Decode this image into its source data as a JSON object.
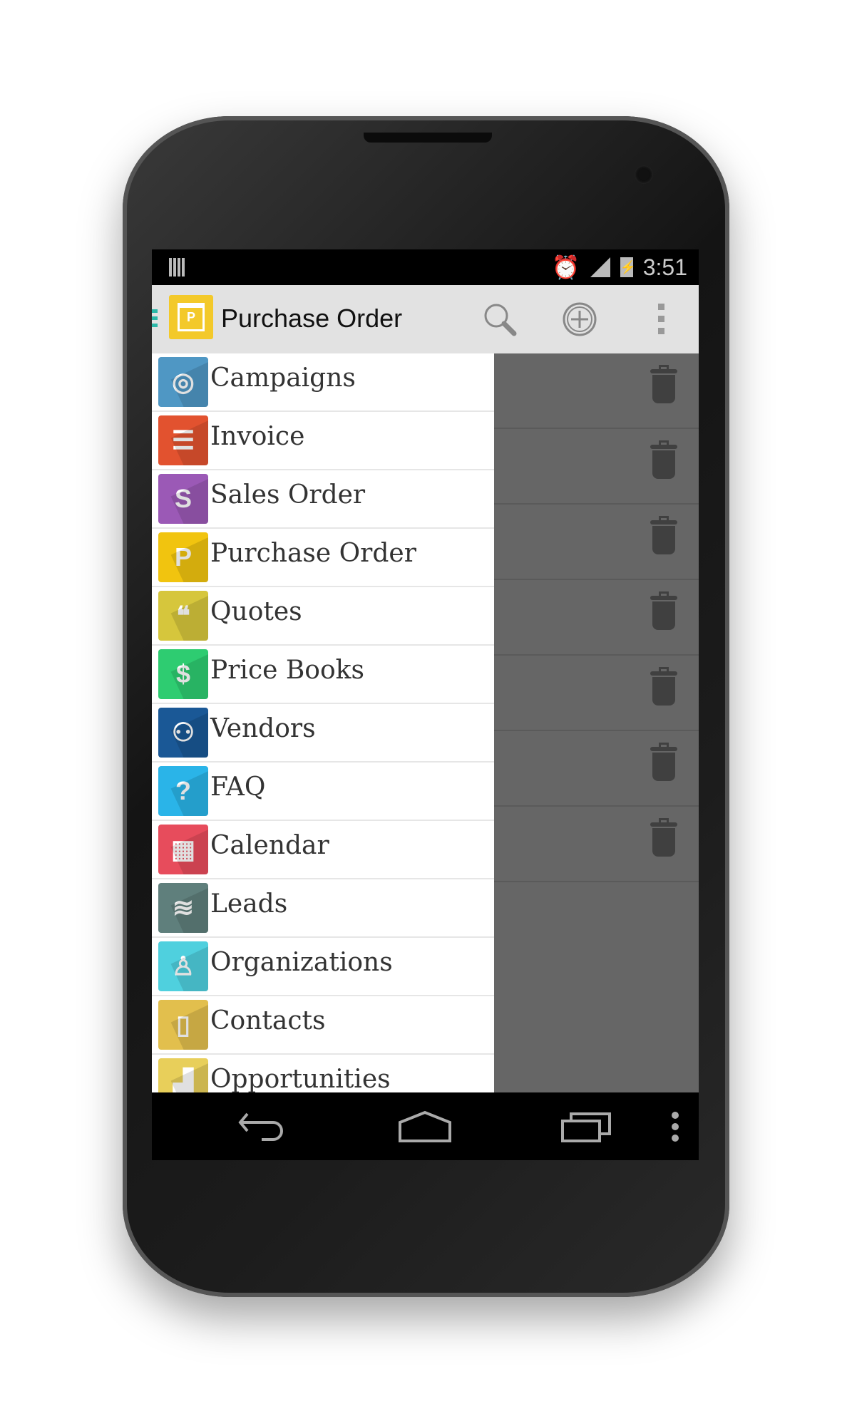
{
  "status_bar": {
    "time": "3:51",
    "icons": [
      "notification-bars-icon",
      "alarm-icon",
      "signal-icon",
      "battery-charging-icon"
    ]
  },
  "action_bar": {
    "title": "Purchase Order",
    "app_icon": "purchase-order-icon",
    "actions": [
      "search-icon",
      "add-circle-icon",
      "overflow-menu-icon"
    ]
  },
  "drawer": {
    "items": [
      {
        "label": "Campaigns",
        "icon": "target-icon",
        "color": "#4f97c4",
        "glyph": "◎"
      },
      {
        "label": "Invoice",
        "icon": "invoice-icon",
        "color": "#e2522f",
        "glyph": "☰"
      },
      {
        "label": "Sales Order",
        "icon": "sales-order-icon",
        "color": "#9b59b6",
        "glyph": "S"
      },
      {
        "label": "Purchase Order",
        "icon": "purchase-order-icon",
        "color": "#f1c40f",
        "glyph": "P"
      },
      {
        "label": "Quotes",
        "icon": "quote-icon",
        "color": "#d6c63c",
        "glyph": "❝"
      },
      {
        "label": "Price Books",
        "icon": "price-book-icon",
        "color": "#2ecc71",
        "glyph": "$"
      },
      {
        "label": "Vendors",
        "icon": "vendor-icon",
        "color": "#1a5896",
        "glyph": "⚇"
      },
      {
        "label": "FAQ",
        "icon": "question-icon",
        "color": "#2ab4e8",
        "glyph": "?"
      },
      {
        "label": "Calendar",
        "icon": "calendar-icon",
        "color": "#e74c5c",
        "glyph": "▦"
      },
      {
        "label": "Leads",
        "icon": "leads-icon",
        "color": "#5f7f7c",
        "glyph": "≋"
      },
      {
        "label": "Organizations",
        "icon": "organization-icon",
        "color": "#4fd0de",
        "glyph": "♙"
      },
      {
        "label": "Contacts",
        "icon": "contacts-icon",
        "color": "#e2bf4d",
        "glyph": "▯"
      },
      {
        "label": "Opportunities",
        "icon": "opportunities-icon",
        "color": "#e8cf5a",
        "glyph": "▟"
      }
    ]
  },
  "content": {
    "trash_rows": 7
  },
  "nav_bar": {
    "buttons": [
      "back-icon",
      "home-icon",
      "recents-icon",
      "menu-icon"
    ]
  }
}
